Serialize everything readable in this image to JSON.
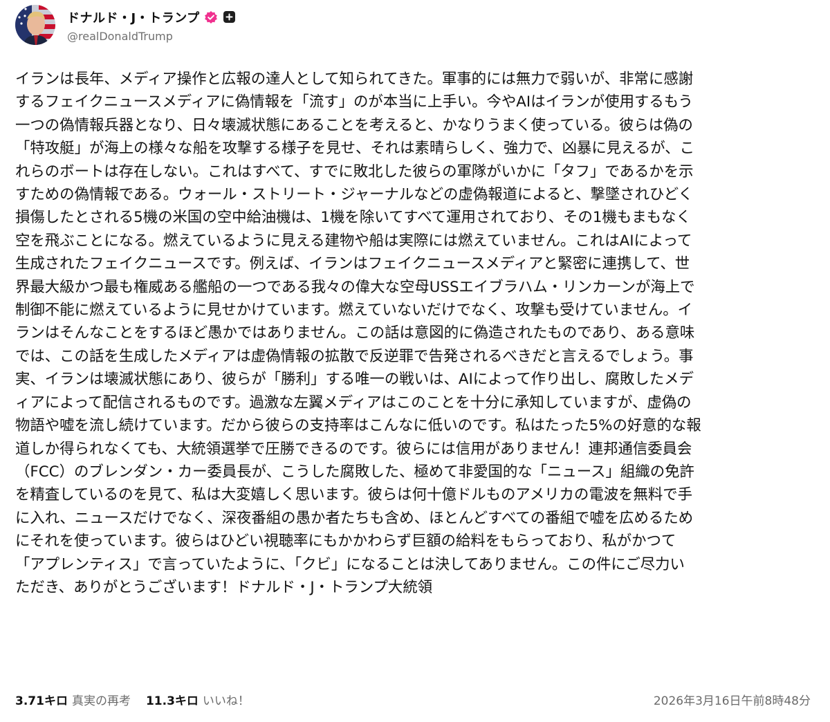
{
  "author": {
    "display_name": "ドナルド・J・トランプ",
    "handle": "@realDonaldTrump",
    "avatar_icon": "profile-photo",
    "verified_badge_icon": "verified-check-icon",
    "verified_color": "#f0318f",
    "extra_badge_icon": "plus-square-icon"
  },
  "post": {
    "lines": [
      "イランは長年、メディア操作と広報の達人として知られてきた。軍事的には無力で弱いが、非常に感謝",
      "するフェイクニュースメディアに偽情報を「流す」のが本当に上手い。今やAIはイランが使用するもう",
      "一つの偽情報兵器となり、日々壊滅状態にあることを考えると、かなりうまく使っている。彼らは偽の",
      "「特攻艇」が海上の様々な船を攻撃する様子を見せ、それは素晴らしく、強力で、凶暴に見えるが、こ",
      "れらのボートは存在しない。これはすべて、すでに敗北した彼らの軍隊がいかに「タフ」であるかを示",
      "すための偽情報である。ウォール・ストリート・ジャーナルなどの虚偽報道によると、撃墜されひどく",
      "損傷したとされる5機の米国の空中給油機は、1機を除いてすべて運用されており、その1機もまもなく",
      "空を飛ぶことになる。燃えているように見える建物や船は実際には燃えていません。これはAIによって",
      "生成されたフェイクニュースです。例えば、イランはフェイクニュースメディアと緊密に連携して、世",
      "界最大級かつ最も権威ある艦船の一つである我々の偉大な空母USSエイブラハム・リンカーンが海上で",
      "制御不能に燃えているように見せかけています。燃えていないだけでなく、攻撃も受けていません。イ",
      "ランはそんなことをするほど愚かではありません。この話は意図的に偽造されたものであり、ある意味",
      "では、この話を生成したメディアは虚偽情報の拡散で反逆罪で告発されるべきだと言えるでしょう。事",
      "実、イランは壊滅状態にあり、彼らが「勝利」する唯一の戦いは、AIによって作り出し、腐敗したメデ",
      "ィアによって配信されるものです。過激な左翼メディアはこのことを十分に承知していますが、虚偽の",
      "物語や嘘を流し続けています。だから彼らの支持率はこんなに低いのです。私はたった5%の好意的な報",
      "道しか得られなくても、大統領選挙で圧勝できるのです。彼らには信用がありません！連邦通信委員会",
      "（FCC）のブレンダン・カー委員長が、こうした腐敗した、極めて非愛国的な「ニュース」組織の免許",
      "を精査しているのを見て、私は大変嬉しく思います。彼らは何十億ドルものアメリカの電波を無料で手",
      "に入れ、ニュースだけでなく、深夜番組の愚か者たちも含め、ほとんどすべての番組で嘘を広めるため",
      "にそれを使っています。彼らはひどい視聴率にもかかわらず巨額の給料をもらっており、私がかつて",
      "「アプレンティス」で言っていたように、「クビ」になることは決してありません。この件にご尽力い",
      "ただき、ありがとうございます！ドナルド・J・トランプ大統領"
    ]
  },
  "stats": {
    "retruths_count": "3.71キロ",
    "retruths_label": "真実の再考",
    "likes_count": "11.3キロ",
    "likes_label": "いいね！"
  },
  "timestamp": "2026年3月16日午前8時48分"
}
